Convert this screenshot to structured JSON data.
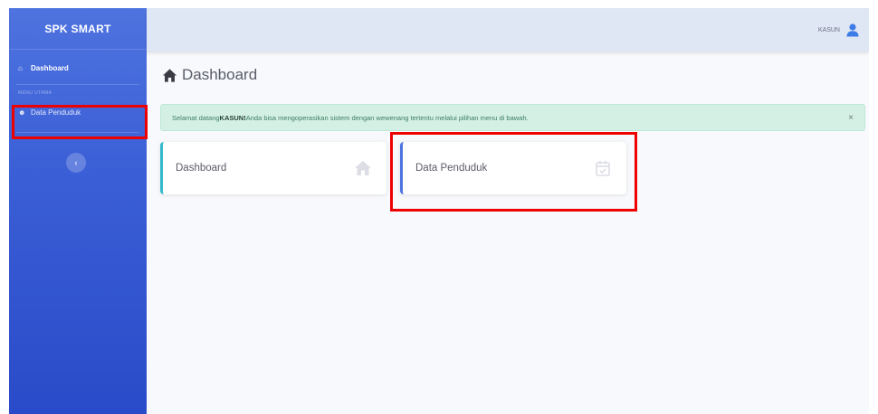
{
  "sidebar": {
    "brand": "SPK SMART",
    "items": [
      {
        "label": "Dashboard",
        "icon": "home-icon"
      },
      {
        "label": "Data Penduduk",
        "icon": "users-icon"
      }
    ],
    "heading": "MENU UTAMA",
    "toggle_icon": "chevron-left-icon"
  },
  "topbar": {
    "user_name": "KASUN",
    "user_icon": "user-icon"
  },
  "page": {
    "title": "Dashboard",
    "title_icon": "home-icon"
  },
  "alert": {
    "prefix": "Selamat datang ",
    "user": "KASUN!",
    "suffix": " Anda bisa mengoperasikan sistem dengan wewenang tertentu melalui pilihan menu di bawah.",
    "close": "×"
  },
  "cards": [
    {
      "label": "Dashboard",
      "icon": "home-icon",
      "accent": "#36b9cc"
    },
    {
      "label": "Data Penduduk",
      "icon": "calendar-check-icon",
      "accent": "#4e73df"
    }
  ],
  "colors": {
    "sidebar_primary": "#4e73df",
    "highlight": "#ee0000",
    "alert_bg": "#d4f0e4"
  }
}
